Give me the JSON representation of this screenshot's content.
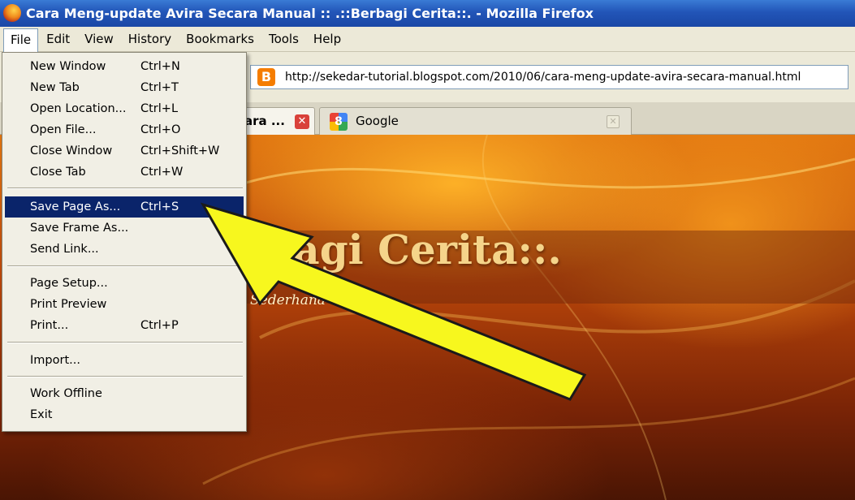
{
  "window": {
    "title": "Cara Meng-update Avira Secara Manual :: .::Berbagi Cerita::. - Mozilla Firefox"
  },
  "menubar": {
    "items": [
      {
        "label": "File"
      },
      {
        "label": "Edit"
      },
      {
        "label": "View"
      },
      {
        "label": "History"
      },
      {
        "label": "Bookmarks"
      },
      {
        "label": "Tools"
      },
      {
        "label": "Help"
      }
    ]
  },
  "navbar": {
    "url": "http://sekedar-tutorial.blogspot.com/2010/06/cara-meng-update-avira-secara-manual.html"
  },
  "tabs": [
    {
      "label": "ara ..."
    },
    {
      "label": "Google"
    }
  ],
  "file_menu": {
    "items": [
      {
        "label": "New Window",
        "shortcut": "Ctrl+N"
      },
      {
        "label": "New Tab",
        "shortcut": "Ctrl+T"
      },
      {
        "label": "Open Location...",
        "shortcut": "Ctrl+L"
      },
      {
        "label": "Open File...",
        "shortcut": "Ctrl+O"
      },
      {
        "label": "Close Window",
        "shortcut": "Ctrl+Shift+W"
      },
      {
        "label": "Close Tab",
        "shortcut": "Ctrl+W"
      },
      {
        "label": "Save Page As...",
        "shortcut": "Ctrl+S"
      },
      {
        "label": "Save Frame As...",
        "shortcut": ""
      },
      {
        "label": "Send Link...",
        "shortcut": ""
      },
      {
        "label": "Page Setup...",
        "shortcut": ""
      },
      {
        "label": "Print Preview",
        "shortcut": ""
      },
      {
        "label": "Print...",
        "shortcut": "Ctrl+P"
      },
      {
        "label": "Import...",
        "shortcut": ""
      },
      {
        "label": "Work Offline",
        "shortcut": ""
      },
      {
        "label": "Exit",
        "shortcut": ""
      }
    ],
    "selected": "Save Page As..."
  },
  "page": {
    "site_title": "rbagi Cerita::.",
    "tagline": "Sederhana Unt      ula"
  },
  "annotation": {
    "arrow_color": "#f7f71e",
    "arrow_stroke": "#1a1a1a"
  },
  "colors": {
    "titlebar": "#2255b8",
    "menu_highlight": "#0a246a"
  }
}
